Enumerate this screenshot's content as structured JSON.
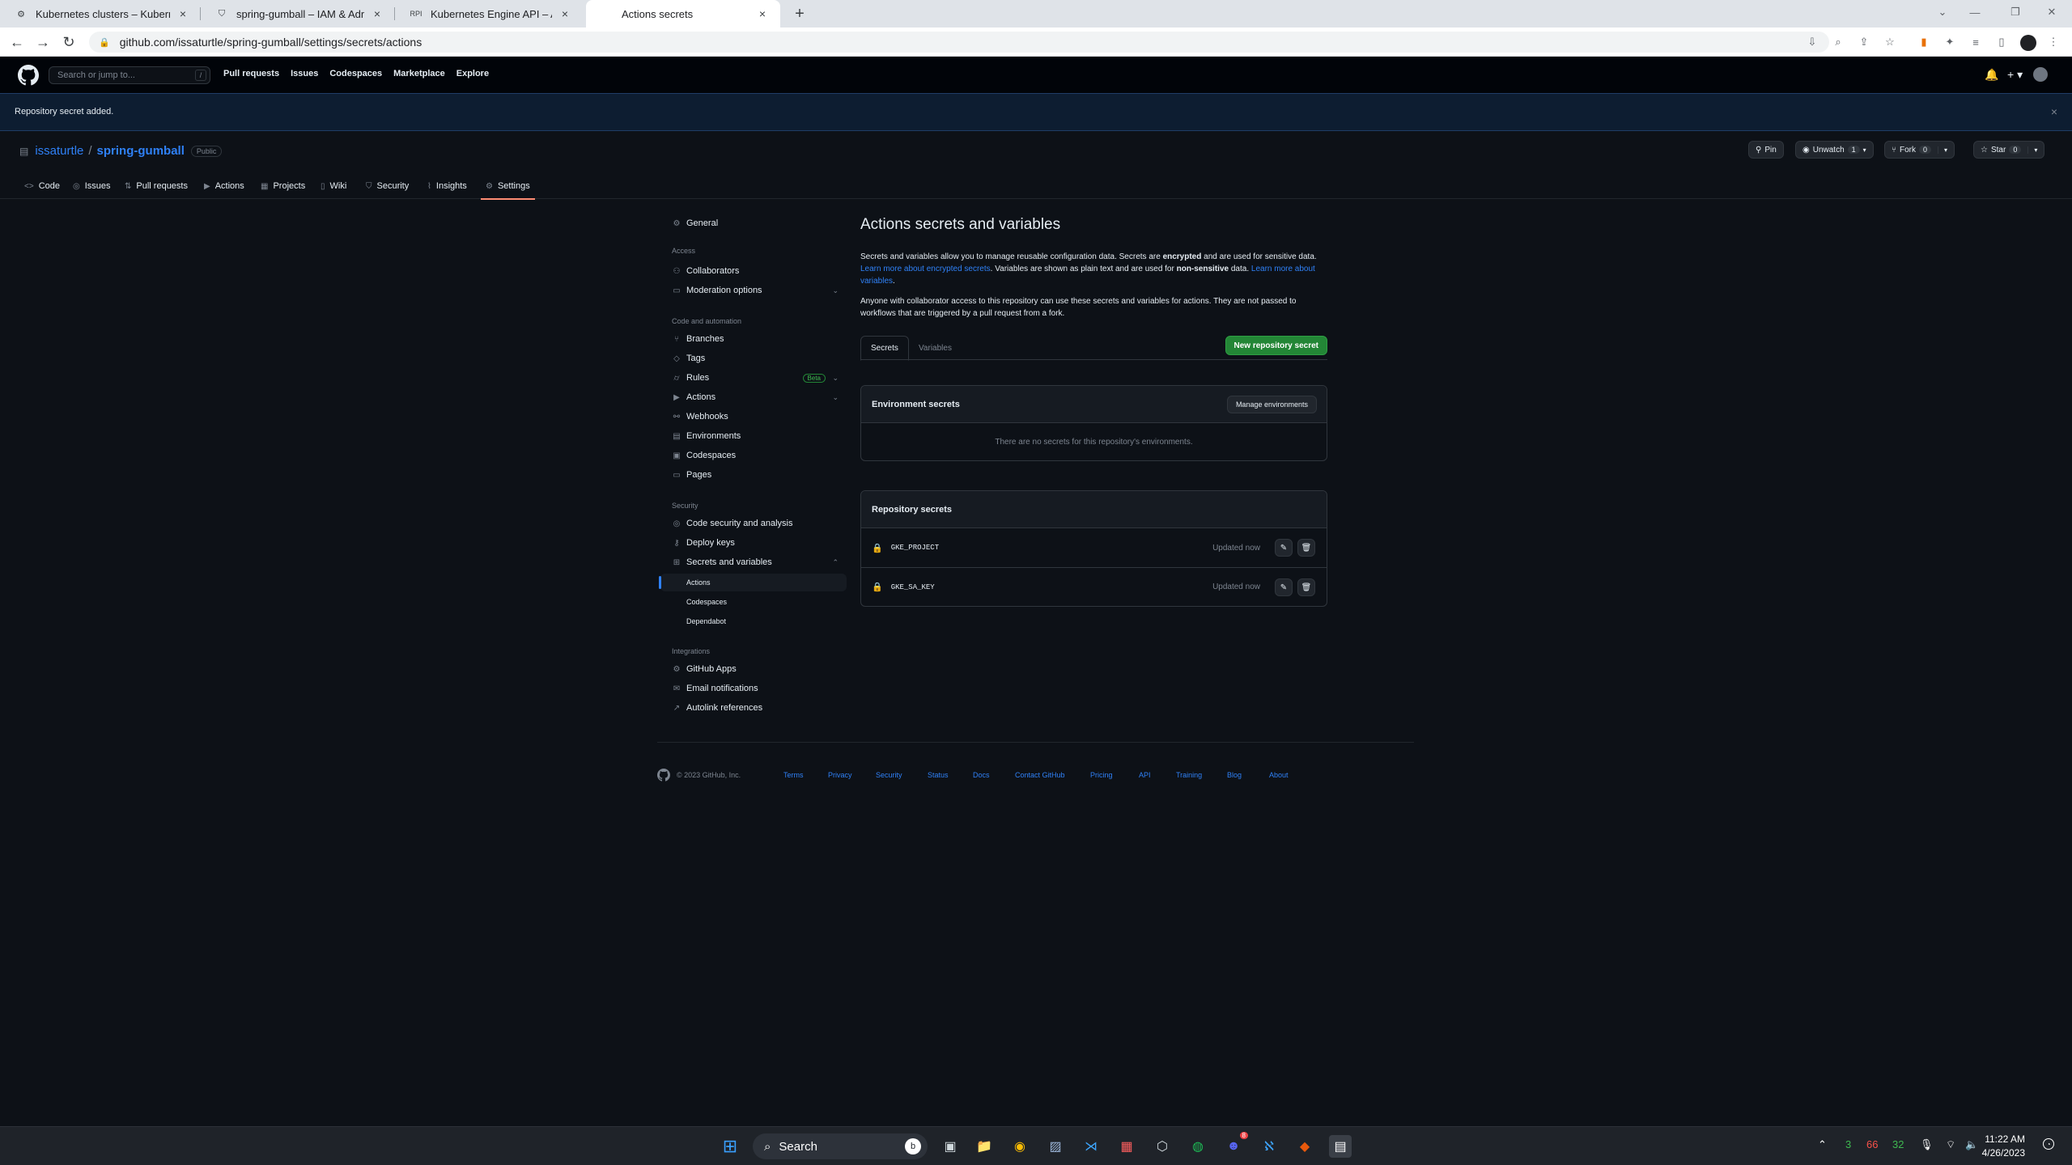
{
  "browser": {
    "tabs": [
      {
        "title": "Kubernetes clusters – Kubernetes",
        "icon": "gear-icon"
      },
      {
        "title": "spring-gumball – IAM & Admin –",
        "icon": "shield-icon"
      },
      {
        "title": "Kubernetes Engine API – APIs &",
        "icon": "api-icon"
      },
      {
        "title": "Actions secrets",
        "icon": "github-icon"
      }
    ],
    "url": "github.com/issaturtle/spring-gumball/settings/secrets/actions"
  },
  "gh_header": {
    "search_placeholder": "Search or jump to...",
    "search_key": "/",
    "nav": [
      "Pull requests",
      "Issues",
      "Codespaces",
      "Marketplace",
      "Explore"
    ]
  },
  "flash": {
    "message": "Repository secret added."
  },
  "repo": {
    "owner": "issaturtle",
    "separator": "/",
    "name": "spring-gumball",
    "visibility": "Public",
    "pin_label": "Pin",
    "unwatch_label": "Unwatch",
    "unwatch_count": "1",
    "fork_label": "Fork",
    "fork_count": "0",
    "star_label": "Star",
    "star_count": "0",
    "tabs": [
      "Code",
      "Issues",
      "Pull requests",
      "Actions",
      "Projects",
      "Wiki",
      "Security",
      "Insights",
      "Settings"
    ]
  },
  "sidebar": {
    "general": "General",
    "access_heading": "Access",
    "collaborators": "Collaborators",
    "moderation": "Moderation options",
    "code_heading": "Code and automation",
    "branches": "Branches",
    "tags": "Tags",
    "rules": "Rules",
    "rules_badge": "Beta",
    "actions": "Actions",
    "webhooks": "Webhooks",
    "environments": "Environments",
    "codespaces": "Codespaces",
    "pages": "Pages",
    "security_heading": "Security",
    "code_security": "Code security and analysis",
    "deploy_keys": "Deploy keys",
    "secrets_vars": "Secrets and variables",
    "sub_actions": "Actions",
    "sub_codespaces": "Codespaces",
    "sub_dependabot": "Dependabot",
    "integrations_heading": "Integrations",
    "github_apps": "GitHub Apps",
    "email_notifications": "Email notifications",
    "autolink": "Autolink references"
  },
  "main": {
    "title": "Actions secrets and variables",
    "desc_1": "Secrets and variables allow you to manage reusable configuration data. Secrets are ",
    "desc_encrypted": "encrypted",
    "desc_2": " and are used for sensitive data. ",
    "desc_link1": "Learn more about encrypted secrets",
    "desc_3": ". Variables are shown as plain text and are used for ",
    "desc_nonsensitive": "non-sensitive",
    "desc_4": " data. ",
    "desc_link2": "Learn more about variables",
    "desc_5": ".",
    "desc_para2": "Anyone with collaborator access to this repository can use these secrets and variables for actions. They are not passed to workflows that are triggered by a pull request from a fork.",
    "tab_secrets": "Secrets",
    "tab_variables": "Variables",
    "new_secret_button": "New repository secret",
    "env_title": "Environment secrets",
    "manage_env_button": "Manage environments",
    "env_empty": "There are no secrets for this repository's environments.",
    "repo_secrets_title": "Repository secrets",
    "secrets": [
      {
        "name": "GKE_PROJECT",
        "updated": "Updated now"
      },
      {
        "name": "GKE_SA_KEY",
        "updated": "Updated now"
      }
    ]
  },
  "footer": {
    "copyright": "© 2023 GitHub, Inc.",
    "links": [
      "Terms",
      "Privacy",
      "Security",
      "Status",
      "Docs",
      "Contact GitHub",
      "Pricing",
      "API",
      "Training",
      "Blog",
      "About"
    ]
  },
  "taskbar": {
    "search_label": "Search",
    "tray_numbers": [
      "3",
      "66",
      "32"
    ],
    "time": "11:22 AM",
    "date": "4/26/2023",
    "discord_badge": "8"
  },
  "colors": {
    "accent_link": "#2f81f7",
    "primary_button": "#238636",
    "tab_underline": "#fd8c73",
    "background": "#0d1117"
  }
}
